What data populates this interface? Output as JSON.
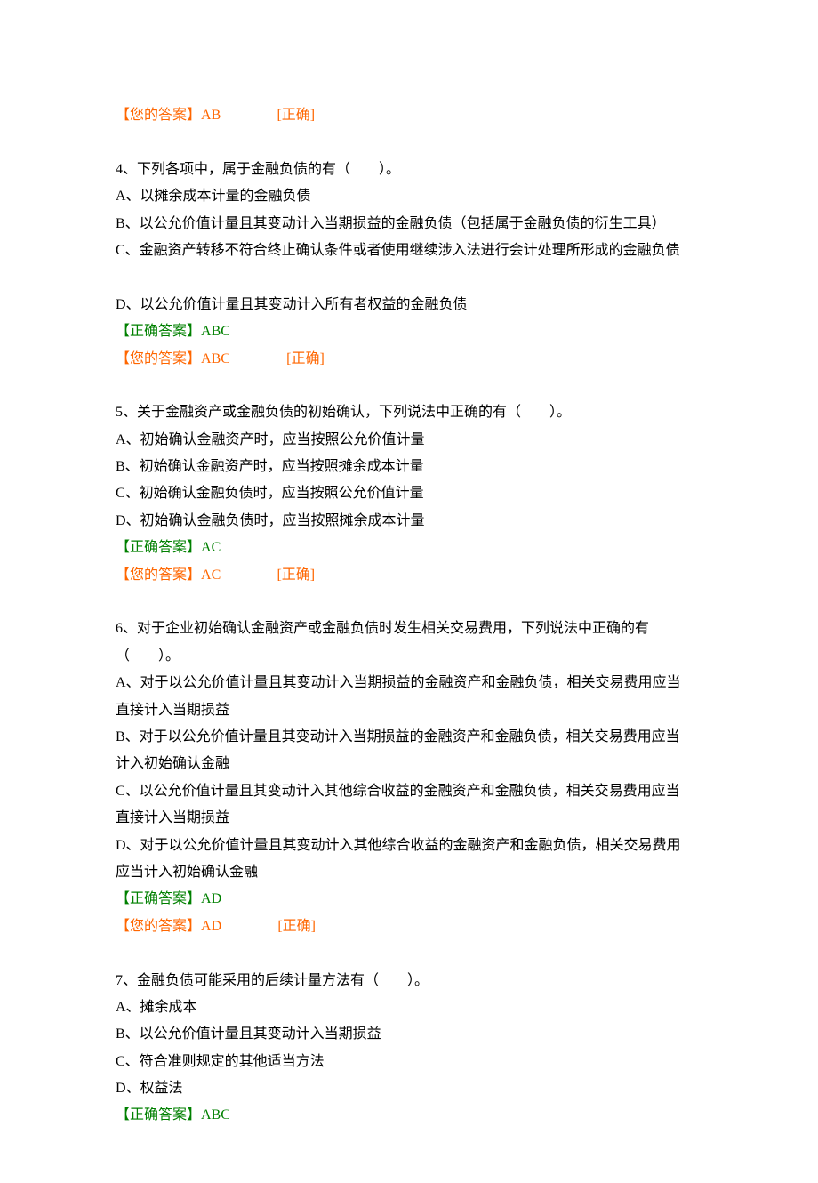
{
  "q3": {
    "your_label": "【您的答案】",
    "your_value": "AB",
    "status": "[正确]"
  },
  "q4": {
    "stem": "4、下列各项中，属于金融负债的有（　　）。",
    "A": "A、以摊余成本计量的金融负债",
    "B": "B、以公允价值计量且其变动计入当期损益的金融负债（包括属于金融负债的衍生工具）",
    "C": "C、金融资产转移不符合终止确认条件或者使用继续涉入法进行会计处理所形成的金融负债",
    "D": "D、以公允价值计量且其变动计入所有者权益的金融负债",
    "correct_label": "【正确答案】",
    "correct_value": "ABC",
    "your_label": "【您的答案】",
    "your_value": "ABC",
    "status": "[正确]"
  },
  "q5": {
    "stem": "5、关于金融资产或金融负债的初始确认，下列说法中正确的有（　　）。",
    "A": "A、初始确认金融资产时，应当按照公允价值计量",
    "B": "B、初始确认金融资产时，应当按照摊余成本计量",
    "C": "C、初始确认金融负债时，应当按照公允价值计量",
    "D": "D、初始确认金融负债时，应当按照摊余成本计量",
    "correct_label": "【正确答案】",
    "correct_value": "AC",
    "your_label": "【您的答案】",
    "your_value": "AC",
    "status": "[正确]"
  },
  "q6": {
    "stem_a": "6、对于企业初始确认金融资产或金融负债时发生相关交易费用，下列说法中正确的有",
    "stem_b": "（　　）。",
    "A1": "A、对于以公允价值计量且其变动计入当期损益的金融资产和金融负债，相关交易费用应当",
    "A2": "直接计入当期损益",
    "B1": "B、对于以公允价值计量且其变动计入当期损益的金融资产和金融负债，相关交易费用应当",
    "B2": "计入初始确认金融",
    "C1": "C、以公允价值计量且其变动计入其他综合收益的金融资产和金融负债，相关交易费用应当",
    "C2": "直接计入当期损益",
    "D1": "D、对于以公允价值计量且其变动计入其他综合收益的金融资产和金融负债，相关交易费用",
    "D2": "应当计入初始确认金融",
    "correct_label": "【正确答案】",
    "correct_value": "AD",
    "your_label": "【您的答案】",
    "your_value": "AD",
    "status": "[正确]"
  },
  "q7": {
    "stem": "7、金融负债可能采用的后续计量方法有（　　）。",
    "A": "A、摊余成本",
    "B": "B、以公允价值计量且其变动计入当期损益",
    "C": "C、符合准则规定的其他适当方法",
    "D": "D、权益法",
    "correct_label": "【正确答案】",
    "correct_value": "ABC"
  }
}
